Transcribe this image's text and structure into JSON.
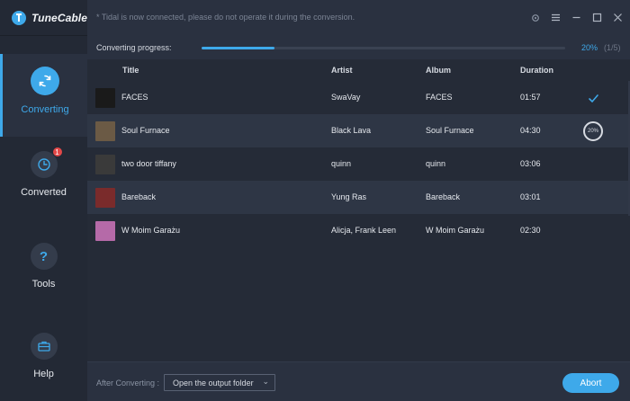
{
  "app": {
    "name": "TuneCable"
  },
  "notice": "* Tidal is now connected, please do not operate it during the conversion.",
  "sidebar": {
    "items": [
      {
        "label": "Converting",
        "icon": "refresh-icon",
        "active": true
      },
      {
        "label": "Converted",
        "icon": "clock-icon",
        "badge": "1"
      },
      {
        "label": "Tools",
        "icon": "question-icon"
      },
      {
        "label": "Help",
        "icon": "toolbox-icon"
      }
    ]
  },
  "progress": {
    "label": "Converting progress:",
    "percent_text": "20%",
    "count_text": "(1/5)",
    "value": 0.2
  },
  "table": {
    "headers": {
      "title": "Title",
      "artist": "Artist",
      "album": "Album",
      "duration": "Duration"
    },
    "rows": [
      {
        "title": "FACES",
        "artist": "SwaVay",
        "album": "FACES",
        "duration": "01:57",
        "status": "done",
        "cover": "#1a1a1a"
      },
      {
        "title": "Soul Furnace",
        "artist": "Black Lava",
        "album": "Soul Furnace",
        "duration": "04:30",
        "status": "converting",
        "progress_text": "20%",
        "cover": "#6b5a45"
      },
      {
        "title": "two door tiffany",
        "artist": "quinn",
        "album": "quinn",
        "duration": "03:06",
        "status": "waiting",
        "cover": "#3a3a3a"
      },
      {
        "title": "Bareback",
        "artist": "Yung Ras",
        "album": "Bareback",
        "duration": "03:01",
        "status": "waiting",
        "cover": "#7a2b2b"
      },
      {
        "title": "W Moim Garażu",
        "artist": "Alicja, Frank Leen",
        "album": "W Moim Garażu",
        "duration": "02:30",
        "status": "waiting",
        "cover": "#b56aa8"
      }
    ]
  },
  "footer": {
    "after_label": "After Converting :",
    "after_value": "Open the output folder",
    "abort_label": "Abort"
  },
  "colors": {
    "accent": "#3ea9ea",
    "badge": "#e34848"
  }
}
